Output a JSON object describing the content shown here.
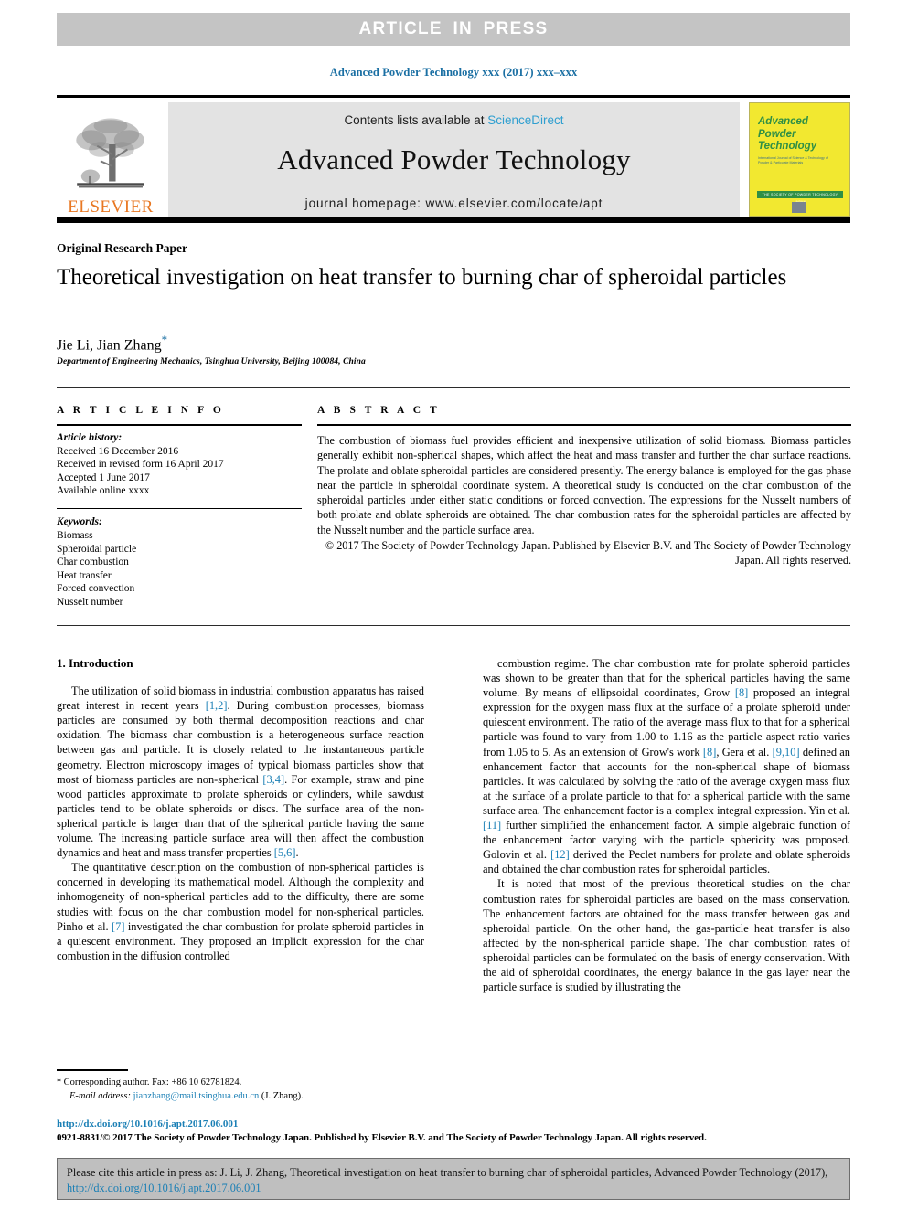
{
  "banner": {
    "text": "ARTICLE  IN  PRESS"
  },
  "running_head": "Advanced Powder Technology xxx (2017) xxx–xxx",
  "masthead": {
    "publisher_name": "ELSEVIER",
    "contents_prefix": "Contents lists available at ",
    "contents_link": "ScienceDirect",
    "journal_title": "Advanced Powder Technology",
    "homepage": "journal homepage: www.elsevier.com/locate/apt",
    "cover": {
      "title_line1": "Advanced",
      "title_line2": "Powder",
      "title_line3": "Technology",
      "subtitle": "International Journal of Science & Technology of Powder & Particulate Materials",
      "band_text": "THE SOCIETY OF POWDER TECHNOLOGY JAPAN"
    }
  },
  "article": {
    "type": "Original Research Paper",
    "title": "Theoretical investigation on heat transfer to burning char of spheroidal particles",
    "authors": "Jie Li, Jian Zhang",
    "corresponding_marker": "*",
    "affiliation": "Department of Engineering Mechanics, Tsinghua University, Beijing 100084, China"
  },
  "info": {
    "heading": "A R T I C L E     I N F O",
    "history_label": "Article history:",
    "history": [
      "Received 16 December 2016",
      "Received in revised form 16 April 2017",
      "Accepted 1 June 2017",
      "Available online xxxx"
    ],
    "keywords_label": "Keywords:",
    "keywords": [
      "Biomass",
      "Spheroidal particle",
      "Char combustion",
      "Heat transfer",
      "Forced convection",
      "Nusselt number"
    ]
  },
  "abstract": {
    "heading": "A B S T R A C T",
    "body": "The combustion of biomass fuel provides efficient and inexpensive utilization of solid biomass. Biomass particles generally exhibit non-spherical shapes, which affect the heat and mass transfer and further the char surface reactions. The prolate and oblate spheroidal particles are considered presently. The energy balance is employed for the gas phase near the particle in spheroidal coordinate system. A theoretical study is conducted on the char combustion of the spheroidal particles under either static conditions or forced convection. The expressions for the Nusselt numbers of both prolate and oblate spheroids are obtained. The char combustion rates for the spheroidal particles are affected by the Nusselt number and the particle surface area.",
    "copyright": "© 2017 The Society of Powder Technology Japan. Published by Elsevier B.V. and The Society of Powder Technology Japan. All rights reserved."
  },
  "body": {
    "section_title": "1. Introduction",
    "left_paragraph_1_a": "The utilization of solid biomass in industrial combustion apparatus has raised great interest in recent years ",
    "left_ref_1": "[1,2]",
    "left_paragraph_1_b": ". During combustion processes, biomass particles are consumed by both thermal decomposition reactions and char oxidation. The biomass char combustion is a heterogeneous surface reaction between gas and particle. It is closely related to the instantaneous particle geometry. Electron microscopy images of typical biomass particles show that most of biomass particles are non-spherical ",
    "left_ref_2": "[3,4]",
    "left_paragraph_1_c": ". For example, straw and pine wood particles approximate to prolate spheroids or cylinders, while sawdust particles tend to be oblate spheroids or discs. The surface area of the non-spherical particle is larger than that of the spherical particle having the same volume. The increasing particle surface area will then affect the combustion dynamics and heat and mass transfer properties ",
    "left_ref_3": "[5,6]",
    "left_paragraph_1_d": ".",
    "left_paragraph_2_a": "The quantitative description on the combustion of non-spherical particles is concerned in developing its mathematical model. Although the complexity and inhomogeneity of non-spherical particles add to the difficulty, there are some studies with focus on the char combustion model for non-spherical particles. Pinho et al. ",
    "left_ref_4": "[7]",
    "left_paragraph_2_b": " investigated the char combustion for prolate spheroid particles in a quiescent environment. They proposed an implicit expression for the char combustion in the diffusion controlled",
    "right_paragraph_1_a": "combustion regime. The char combustion rate for prolate spheroid particles was shown to be greater than that for the spherical particles having the same volume. By means of ellipsoidal coordinates, Grow ",
    "right_ref_1": "[8]",
    "right_paragraph_1_b": " proposed an integral expression for the oxygen mass flux at the surface of a prolate spheroid under quiescent environment. The ratio of the average mass flux to that for a spherical particle was found to vary from 1.00 to 1.16 as the particle aspect ratio varies from 1.05 to 5. As an extension of Grow's work ",
    "right_ref_2": "[8]",
    "right_paragraph_1_c": ", Gera et al. ",
    "right_ref_3": "[9,10]",
    "right_paragraph_1_d": " defined an enhancement factor that accounts for the non-spherical shape of biomass particles. It was calculated by solving the ratio of the average oxygen mass flux at the surface of a prolate particle to that for a spherical particle with the same surface area. The enhancement factor is a complex integral expression. Yin et al. ",
    "right_ref_4": "[11]",
    "right_paragraph_1_e": " further simplified the enhancement factor. A simple algebraic function of the enhancement factor varying with the particle sphericity was proposed. Golovin et al. ",
    "right_ref_5": "[12]",
    "right_paragraph_1_f": " derived the Peclet numbers for prolate and oblate spheroids and obtained the char combustion rates for spheroidal particles.",
    "right_paragraph_2": "It is noted that most of the previous theoretical studies on the char combustion rates for spheroidal particles are based on the mass conservation. The enhancement factors are obtained for the mass transfer between gas and spheroidal particle. On the other hand, the gas-particle heat transfer is also affected by the non-spherical particle shape. The char combustion rates of spheroidal particles can be formulated on the basis of energy conservation. With the aid of spheroidal coordinates, the energy balance in the gas layer near the particle surface is studied by illustrating the"
  },
  "footnote": {
    "star": "*",
    "corresponding": " Corresponding author. Fax: +86 10 62781824.",
    "email_label": "E-mail address:",
    "email": "jianzhang@mail.tsinghua.edu.cn",
    "email_suffix": " (J. Zhang)."
  },
  "footer": {
    "doi": "http://dx.doi.org/10.1016/j.apt.2017.06.001",
    "issn_copyright": "0921-8831/© 2017 The Society of Powder Technology Japan. Published by Elsevier B.V. and The Society of Powder Technology Japan. All rights reserved."
  },
  "cite_box": {
    "prefix": "Please cite this article in press as: J. Li, J. Zhang, Theoretical investigation on heat transfer to burning char of spheroidal particles, Advanced Powder Technology (2017), ",
    "link": "http://dx.doi.org/10.1016/j.apt.2017.06.001"
  },
  "colors": {
    "banner_bg": "#c4c4c4",
    "masthead_band": "#e3e3e3",
    "link_blue": "#1a7fb5",
    "sciencedirect_blue": "#2f9fd0",
    "elsevier_orange": "#e87722",
    "cover_yellow": "#f2e830",
    "cover_green": "#2f8f45",
    "cite_box_bg": "#bfbfbf"
  }
}
